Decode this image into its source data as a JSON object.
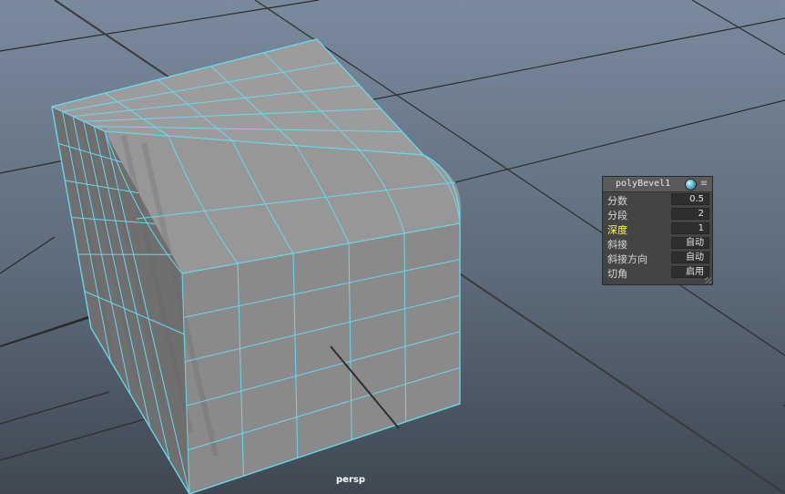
{
  "viewport": {
    "camera_label": "persp"
  },
  "channel_box": {
    "title": "polyBevel1",
    "globe_icon": "globe-icon",
    "menu_icon": "menu-icon",
    "rows": [
      {
        "label": "分数",
        "value": "0.5",
        "highlight": false
      },
      {
        "label": "分段",
        "value": "2",
        "highlight": false
      },
      {
        "label": "深度",
        "value": "1",
        "highlight": true
      },
      {
        "label": "斜接",
        "value": "自动",
        "highlight": false
      },
      {
        "label": "斜接方向",
        "value": "自动",
        "highlight": false
      },
      {
        "label": "切角",
        "value": "启用",
        "highlight": false
      }
    ]
  },
  "colors": {
    "wireframe": "#6ad8ee",
    "mesh_face": "#8a8a8a",
    "mesh_face_light": "#9c9c9c",
    "mesh_face_dark": "#6f6f6f",
    "grid_line": "#2c2c2c",
    "label_highlight": "#ffff50"
  }
}
